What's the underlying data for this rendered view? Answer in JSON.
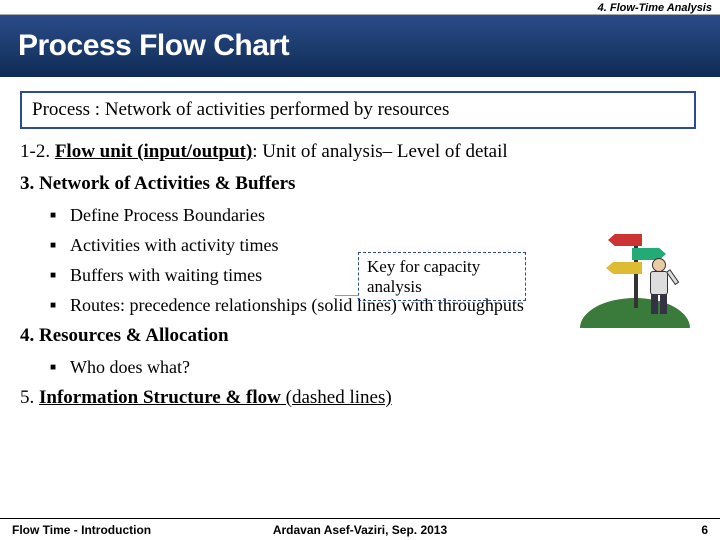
{
  "header": {
    "chapter": "4. Flow-Time Analysis"
  },
  "title": "Process Flow Chart",
  "process_definition": "Process : Network of activities performed by resources",
  "items": {
    "one_two_prefix": "1-2. ",
    "one_two_label": "Flow unit (input/output)",
    "one_two_rest": ": Unit of analysis– Level of detail",
    "three": "3. Network of Activities & Buffers",
    "four": "4. Resources & Allocation",
    "five_prefix": "5. ",
    "five_label": "Information Structure & flow",
    "five_rest": " (dashed lines)"
  },
  "bullets3": {
    "b1": "Define Process Boundaries",
    "b2": "Activities with activity times",
    "b3": "Buffers with waiting times",
    "b4": "Routes: precedence relationships (solid lines) with throughputs"
  },
  "bullets4": {
    "b1": "Who does what?"
  },
  "keybox": "Key for  capacity analysis",
  "footer": {
    "left": "Flow Time - Introduction",
    "center": "Ardavan Asef-Vaziri, Sep. 2013",
    "right": "6"
  }
}
